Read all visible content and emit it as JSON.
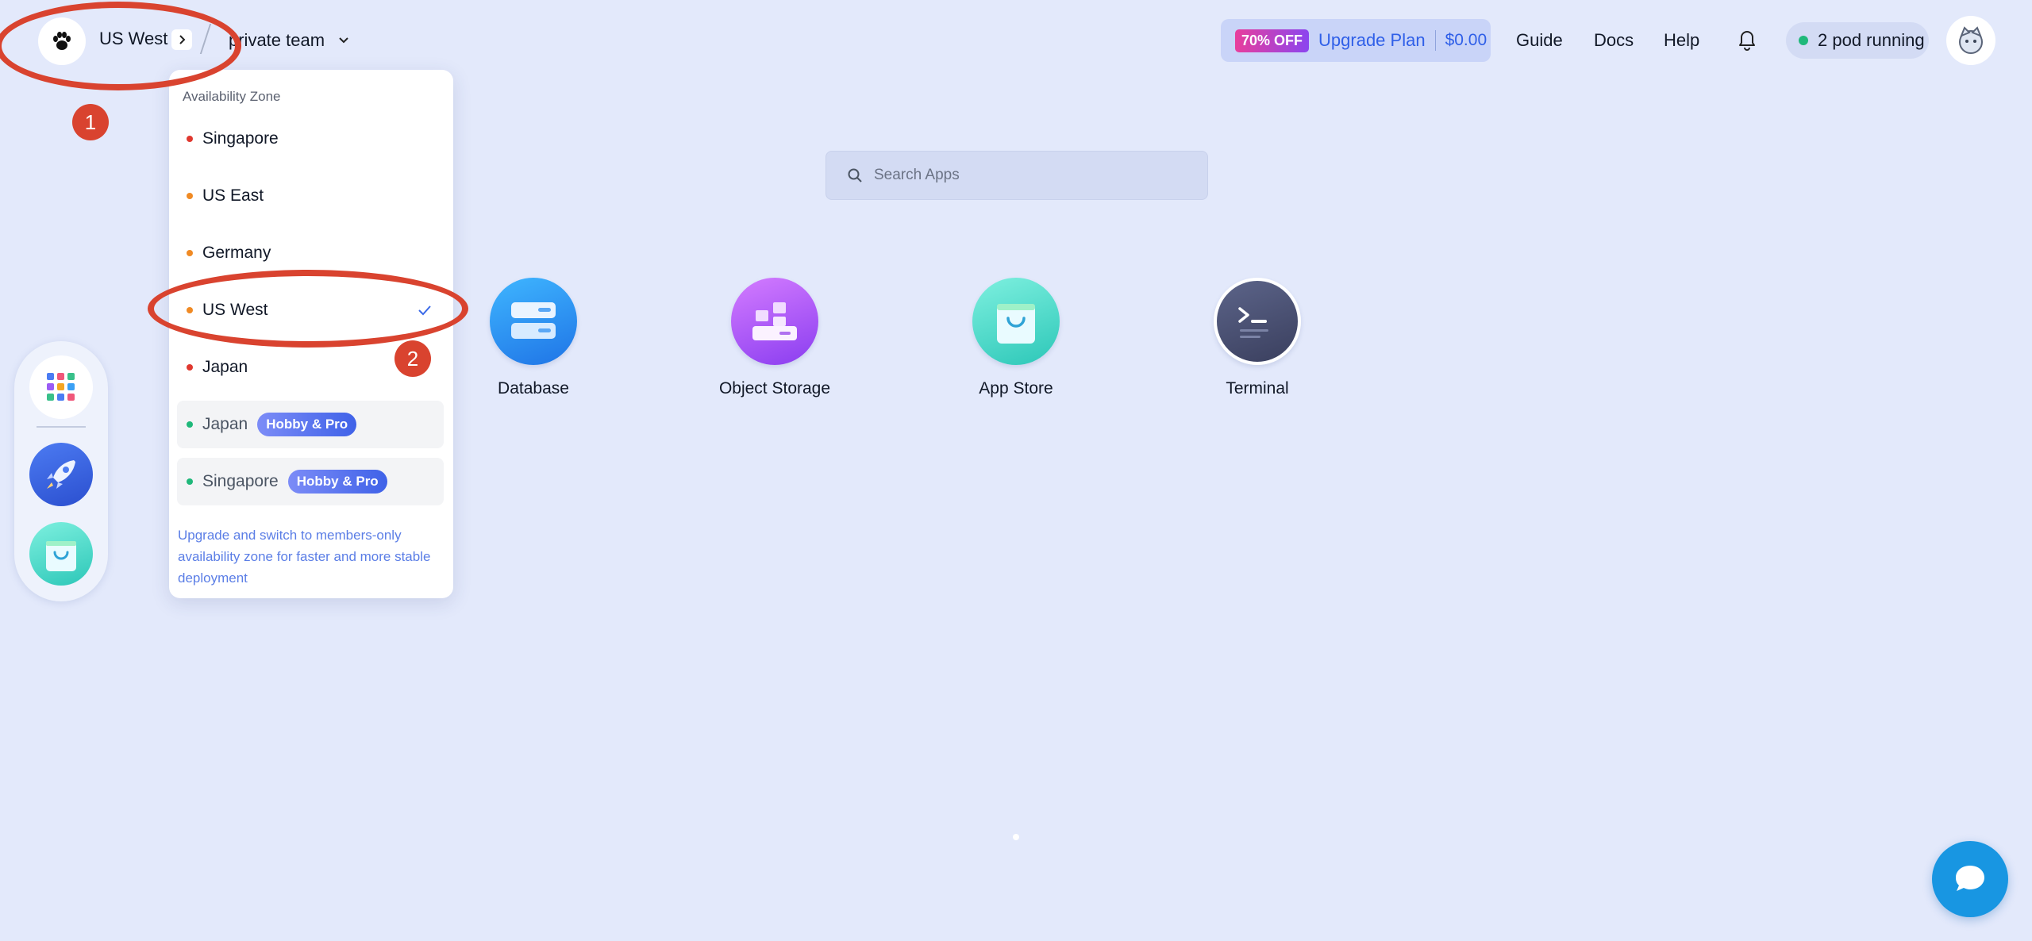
{
  "header": {
    "region_label": "US West",
    "team_label": "private team",
    "upgrade": {
      "discount_badge": "70% OFF",
      "label": "Upgrade Plan",
      "price": "$0.00"
    },
    "nav": {
      "guide": "Guide",
      "docs": "Docs",
      "help": "Help"
    },
    "pods_status": "2 pod running"
  },
  "search": {
    "placeholder": "Search Apps"
  },
  "apps": [
    {
      "label": "Database",
      "icon": "database-icon"
    },
    {
      "label": "Object Storage",
      "icon": "object-storage-icon"
    },
    {
      "label": "App Store",
      "icon": "shopping-bag-icon"
    },
    {
      "label": "Terminal",
      "icon": "terminal-icon"
    }
  ],
  "dock": [
    {
      "icon": "app-grid-icon"
    },
    {
      "icon": "rocket-icon"
    },
    {
      "icon": "shopping-bag-icon"
    }
  ],
  "zone_dropdown": {
    "heading": "Availability Zone",
    "zones": [
      {
        "label": "Singapore",
        "dot_color": "#e0382f"
      },
      {
        "label": "US East",
        "dot_color": "#f08a24"
      },
      {
        "label": "Germany",
        "dot_color": "#f08a24"
      },
      {
        "label": "US West",
        "dot_color": "#f08a24",
        "selected": true
      },
      {
        "label": "Japan",
        "dot_color": "#e0382f"
      }
    ],
    "members_zones": [
      {
        "label": "Japan",
        "badge": "Hobby & Pro",
        "dot_color": "#1fb87a"
      },
      {
        "label": "Singapore",
        "badge": "Hobby & Pro",
        "dot_color": "#1fb87a"
      }
    ],
    "note": "Upgrade and switch to members-only availability zone for faster and more stable deployment"
  },
  "annotations": {
    "step1": "1",
    "step2": "2"
  },
  "colors": {
    "background": "#e3e9fb",
    "accent": "#2f5fe8",
    "annotation_red": "#d9432f",
    "chat_button": "#1896e2",
    "status_green": "#1fb87a"
  }
}
